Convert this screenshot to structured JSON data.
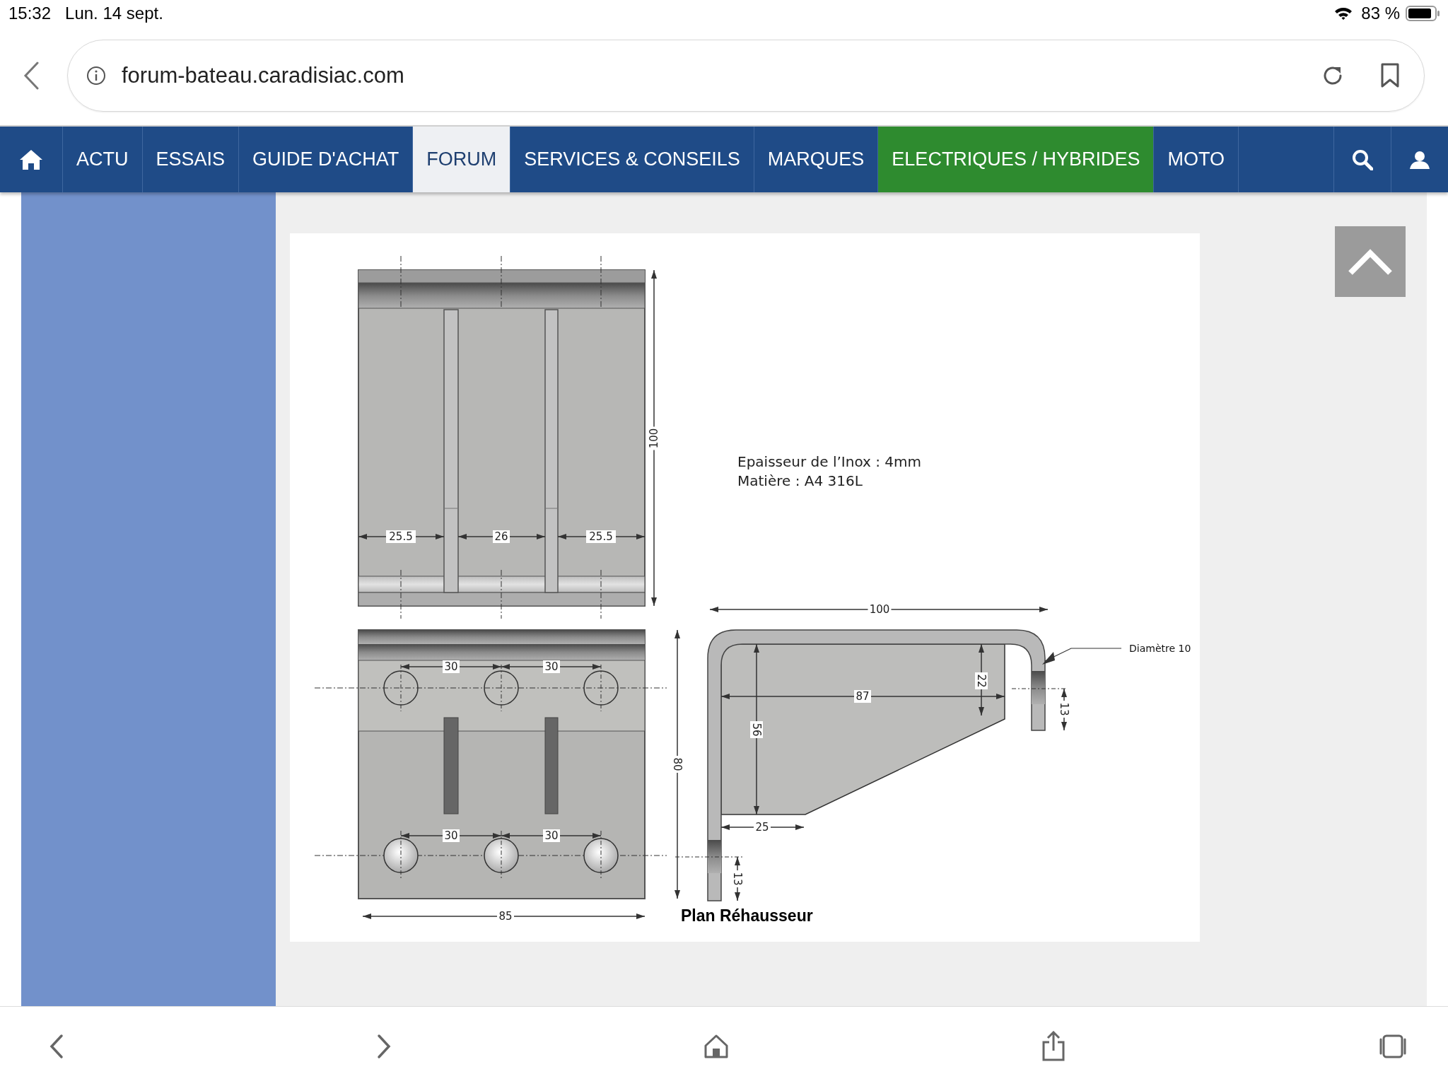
{
  "status_bar": {
    "time": "15:32",
    "date": "Lun. 14 sept.",
    "battery": "83 %"
  },
  "address_bar": {
    "url": "forum-bateau.caradisiac.com"
  },
  "nav": {
    "items": [
      {
        "label": "ACTU",
        "selected": false,
        "highlighted": false
      },
      {
        "label": "ESSAIS",
        "selected": false,
        "highlighted": false
      },
      {
        "label": "GUIDE D'ACHAT",
        "selected": false,
        "highlighted": false
      },
      {
        "label": "FORUM",
        "selected": true,
        "highlighted": false
      },
      {
        "label": "SERVICES & CONSEILS",
        "selected": false,
        "highlighted": false
      },
      {
        "label": "MARQUES",
        "selected": false,
        "highlighted": false
      },
      {
        "label": "ELECTRIQUES / HYBRIDES",
        "selected": false,
        "highlighted": true
      },
      {
        "label": "MOTO",
        "selected": false,
        "highlighted": false
      }
    ]
  },
  "drawing": {
    "notes": [
      "Epaisseur de l’Inox : 4mm",
      "Matière : A4 316L"
    ],
    "caption": "Plan Réhausseur",
    "callout": "Diamètre 10",
    "top_view_dims": [
      "100",
      "25.5",
      "26",
      "25.5"
    ],
    "front_view_dims": [
      "30",
      "30",
      "30",
      "30",
      "80",
      "85"
    ],
    "side_view_dims": [
      "100",
      "87",
      "22",
      "56",
      "25",
      "13",
      "13"
    ]
  }
}
